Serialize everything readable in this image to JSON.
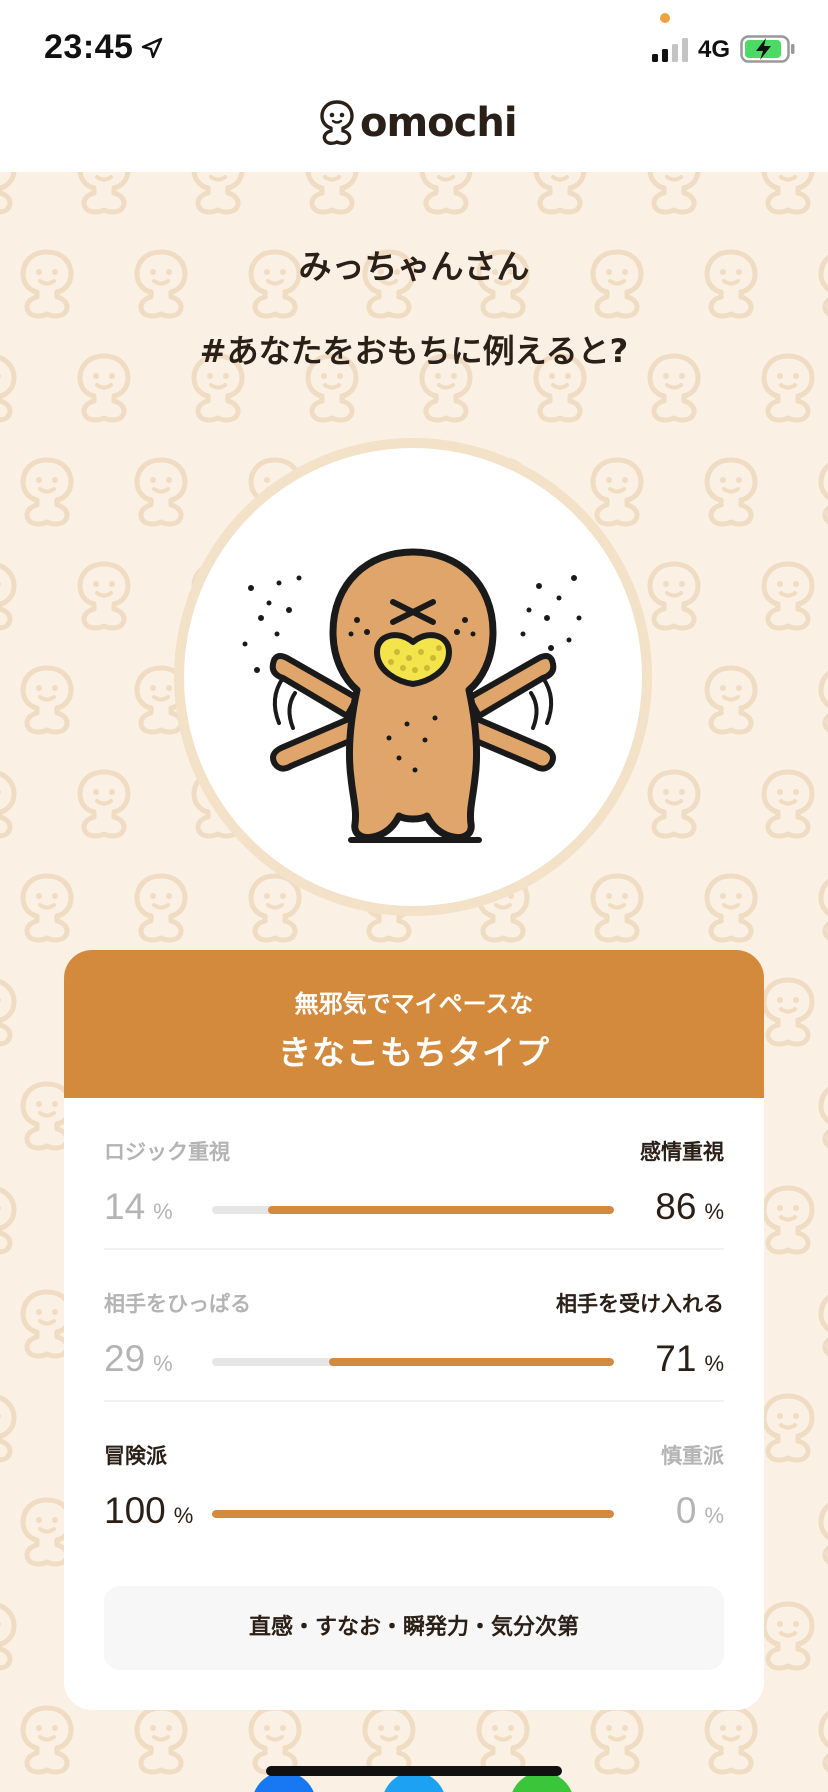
{
  "status_bar": {
    "time": "23:45",
    "network": "4G",
    "icons": [
      "location-arrow-icon",
      "signal-bars-icon",
      "battery-charging-icon"
    ]
  },
  "header": {
    "logo_text": "omochi"
  },
  "result": {
    "user_name": "みっちゃんさん",
    "question": "#あなたをおもちに例えると?",
    "subtitle": "無邪気でマイペースな",
    "type_name": "きなこもちタイプ"
  },
  "metrics": [
    {
      "left_label": "ロジック重視",
      "right_label": "感情重視",
      "left_value": "14",
      "right_value": "86",
      "unit": "%",
      "right_fraction": 0.86,
      "dominant": "right"
    },
    {
      "left_label": "相手をひっぱる",
      "right_label": "相手を受け入れる",
      "left_value": "29",
      "right_value": "71",
      "unit": "%",
      "right_fraction": 0.71,
      "dominant": "right"
    },
    {
      "left_label": "冒険派",
      "right_label": "慎重派",
      "left_value": "100",
      "right_value": "0",
      "unit": "%",
      "right_fraction": 1.0,
      "dominant": "left"
    }
  ],
  "traits": "直感・すなお・瞬発力・気分次第",
  "colors": {
    "accent": "#d48a3c",
    "background": "#faf0e4",
    "muted_text": "#b4b4b4",
    "dark_text": "#2b2018"
  },
  "share_buttons": [
    {
      "icon": "facebook-icon",
      "color": "#1877f2"
    },
    {
      "icon": "twitter-icon",
      "color": "#1da1f2"
    },
    {
      "icon": "line-icon",
      "color": "#3ac53a"
    }
  ]
}
